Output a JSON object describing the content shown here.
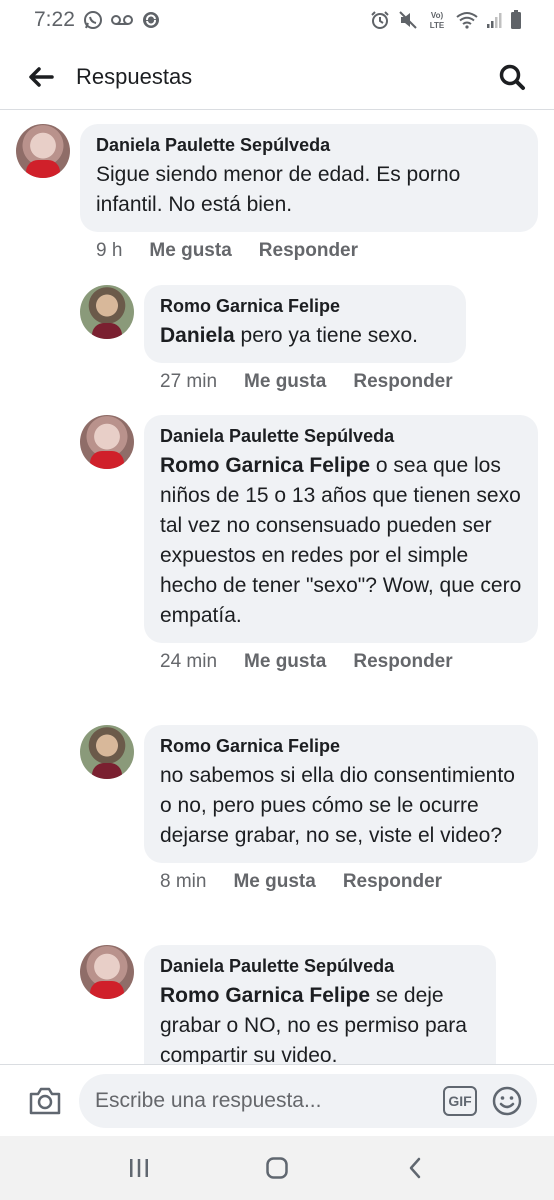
{
  "status_bar": {
    "time": "7:22",
    "left_icons": [
      "whatsapp-icon",
      "voicemail-icon",
      "sync-icon"
    ],
    "right_icons": [
      "alarm-icon",
      "mute-icon",
      "volte-icon",
      "wifi-icon",
      "signal-icon",
      "battery-icon"
    ],
    "volte_label_top": "Vo)",
    "volte_label_bottom": "LTE"
  },
  "header": {
    "title": "Respuestas",
    "back_icon": "arrow-left-icon",
    "search_icon": "search-icon"
  },
  "comments": [
    {
      "author": "Daniela Paulette Sepúlveda",
      "mention": "",
      "text": "Sigue siendo menor de edad. Es porno infantil. No está bien.",
      "time": "9 h",
      "like_label": "Me gusta",
      "reply_label": "Responder"
    },
    {
      "author": "Romo Garnica Felipe",
      "mention": "Daniela",
      "text": " pero ya tiene sexo.",
      "time": "27 min",
      "like_label": "Me gusta",
      "reply_label": "Responder"
    },
    {
      "author": "Daniela Paulette Sepúlveda",
      "mention": "Romo Garnica Felipe",
      "text": " o sea que los niños de 15 o 13 años que tienen sexo tal vez no consensuado pueden ser expuestos en redes por el simple hecho de tener \"sexo\"? Wow, que cero empatía.",
      "time": "24 min",
      "like_label": "Me gusta",
      "reply_label": "Responder"
    },
    {
      "author": "Romo Garnica Felipe",
      "mention": "",
      "text": "no sabemos si ella dio consentimiento o no, pero pues cómo se le ocurre dejarse grabar, no se, viste el video?",
      "time": "8 min",
      "like_label": "Me gusta",
      "reply_label": "Responder"
    },
    {
      "author": "Daniela Paulette Sepúlveda",
      "mention": "Romo Garnica Felipe",
      "text": " se deje grabar o NO, no es permiso para compartir su video.",
      "time": "",
      "like_label": "",
      "reply_label": ""
    }
  ],
  "composer": {
    "placeholder": "Escribe una respuesta...",
    "gif_label": "GIF",
    "camera_icon": "camera-icon",
    "emoji_icon": "emoji-icon"
  },
  "nav_bar": {
    "icons": [
      "recent-apps-icon",
      "home-icon",
      "back-icon"
    ]
  }
}
